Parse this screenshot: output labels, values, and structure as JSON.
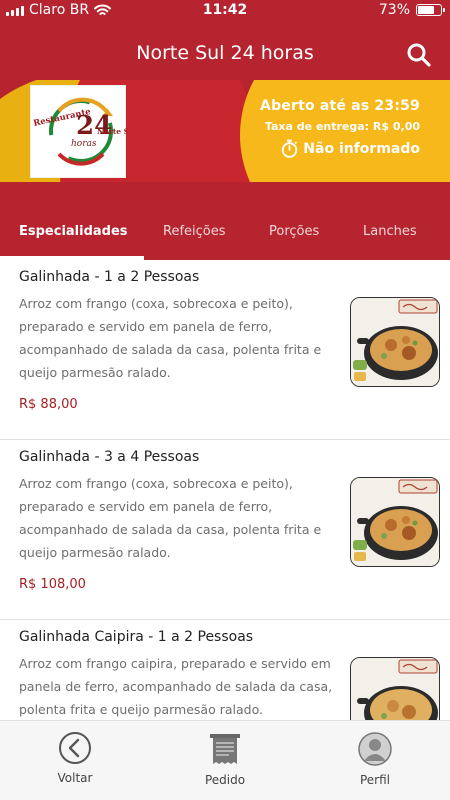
{
  "status_bar": {
    "carrier": "Claro BR",
    "time": "11:42",
    "battery": "73%",
    "battery_level": 0.73
  },
  "app_bar": {
    "title": "Norte Sul 24 horas",
    "search_icon": "search-icon"
  },
  "restaurant": {
    "logo_text": [
      "Restaurante",
      "24",
      "Norte Sul",
      "horas"
    ],
    "open_until": "Aberto até as 23:59",
    "delivery_fee": "Taxa de entrega: R$ 0,00",
    "delivery_time": "Não informado",
    "delivery_time_icon": "stopwatch-icon"
  },
  "tabs": [
    {
      "label": "Especialidades",
      "active": true
    },
    {
      "label": "Refeições",
      "active": false
    },
    {
      "label": "Porções",
      "active": false
    },
    {
      "label": "Lanches",
      "active": false
    }
  ],
  "items": [
    {
      "name": "Galinhada - 1 a 2 Pessoas",
      "description": "Arroz com frango (coxa, sobrecoxa e peito), preparado e servido em panela de ferro, acompanhado de salada da casa, polenta frita e queijo parmesão ralado.",
      "price": "R$ 88,00"
    },
    {
      "name": "Galinhada - 3 a 4 Pessoas",
      "description": "Arroz com frango (coxa, sobrecoxa e peito), preparado e servido em panela de ferro, acompanhado de salada da casa, polenta frita e queijo parmesão ralado.",
      "price": "R$ 108,00"
    },
    {
      "name": "Galinhada Caipira - 1 a 2 Pessoas",
      "description": "Arroz com frango caipira, preparado e servido em panela de ferro, acompanhado de salada da casa, polenta frita e queijo parmesão ralado.",
      "price": ""
    }
  ],
  "bottom_nav": [
    {
      "label": "Voltar",
      "icon": "back-arrow-icon"
    },
    {
      "label": "Pedido",
      "icon": "receipt-icon"
    },
    {
      "label": "Perfil",
      "icon": "user-icon"
    }
  ],
  "colors": {
    "brand_red": "#b5242f",
    "brand_yellow": "#f6b81a",
    "price_red": "#a41f23"
  }
}
